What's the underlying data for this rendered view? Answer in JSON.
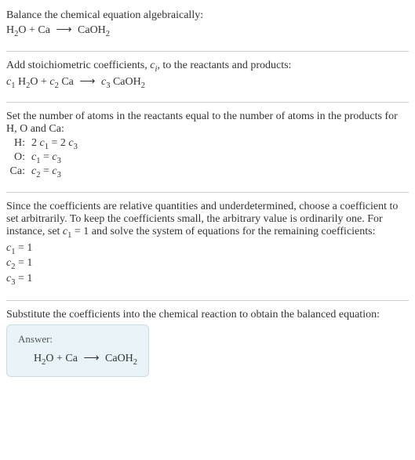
{
  "section1": {
    "title": "Balance the chemical equation algebraically:",
    "eq_lhs1": "H",
    "eq_sub1": "2",
    "eq_lhs2": "O + Ca ",
    "arrow": "⟶",
    "eq_rhs": " CaOH",
    "eq_rhs_sub": "2"
  },
  "section2": {
    "title_a": "Add stoichiometric coefficients, ",
    "title_ci": "c",
    "title_ci_sub": "i",
    "title_b": ", to the reactants and products:",
    "c1": "c",
    "c1sub": "1",
    "sp1": " H",
    "sp1sub": "2",
    "sp1b": "O + ",
    "c2": "c",
    "c2sub": "2",
    "sp2": " Ca ",
    "arrow": "⟶",
    "c3": " c",
    "c3sub": "3",
    "sp3": " CaOH",
    "sp3sub": "2"
  },
  "section3": {
    "title": "Set the number of atoms in the reactants equal to the number of atoms in the products for H, O and Ca:",
    "rows": [
      {
        "label": "H:",
        "eq_a": "2 ",
        "eq_c1": "c",
        "eq_c1s": "1",
        "eq_mid": " = 2 ",
        "eq_c2": "c",
        "eq_c2s": "3"
      },
      {
        "label": "O:",
        "eq_a": "",
        "eq_c1": "c",
        "eq_c1s": "1",
        "eq_mid": " = ",
        "eq_c2": "c",
        "eq_c2s": "3"
      },
      {
        "label": "Ca:",
        "eq_a": "",
        "eq_c1": "c",
        "eq_c1s": "2",
        "eq_mid": " = ",
        "eq_c2": "c",
        "eq_c2s": "3"
      }
    ]
  },
  "section4": {
    "text_a": "Since the coefficients are relative quantities and underdetermined, choose a coefficient to set arbitrarily. To keep the coefficients small, the arbitrary value is ordinarily one. For instance, set ",
    "cvar": "c",
    "csub": "1",
    "text_b": " = 1 and solve the system of equations for the remaining coefficients:",
    "coeffs": [
      {
        "c": "c",
        "s": "1",
        "v": " = 1"
      },
      {
        "c": "c",
        "s": "2",
        "v": " = 1"
      },
      {
        "c": "c",
        "s": "3",
        "v": " = 1"
      }
    ]
  },
  "section5": {
    "title": "Substitute the coefficients into the chemical reaction to obtain the balanced equation:",
    "answer_label": "Answer:",
    "eq_lhs1": "H",
    "eq_sub1": "2",
    "eq_lhs2": "O + Ca ",
    "arrow": "⟶",
    "eq_rhs": " CaOH",
    "eq_rhs_sub": "2"
  }
}
